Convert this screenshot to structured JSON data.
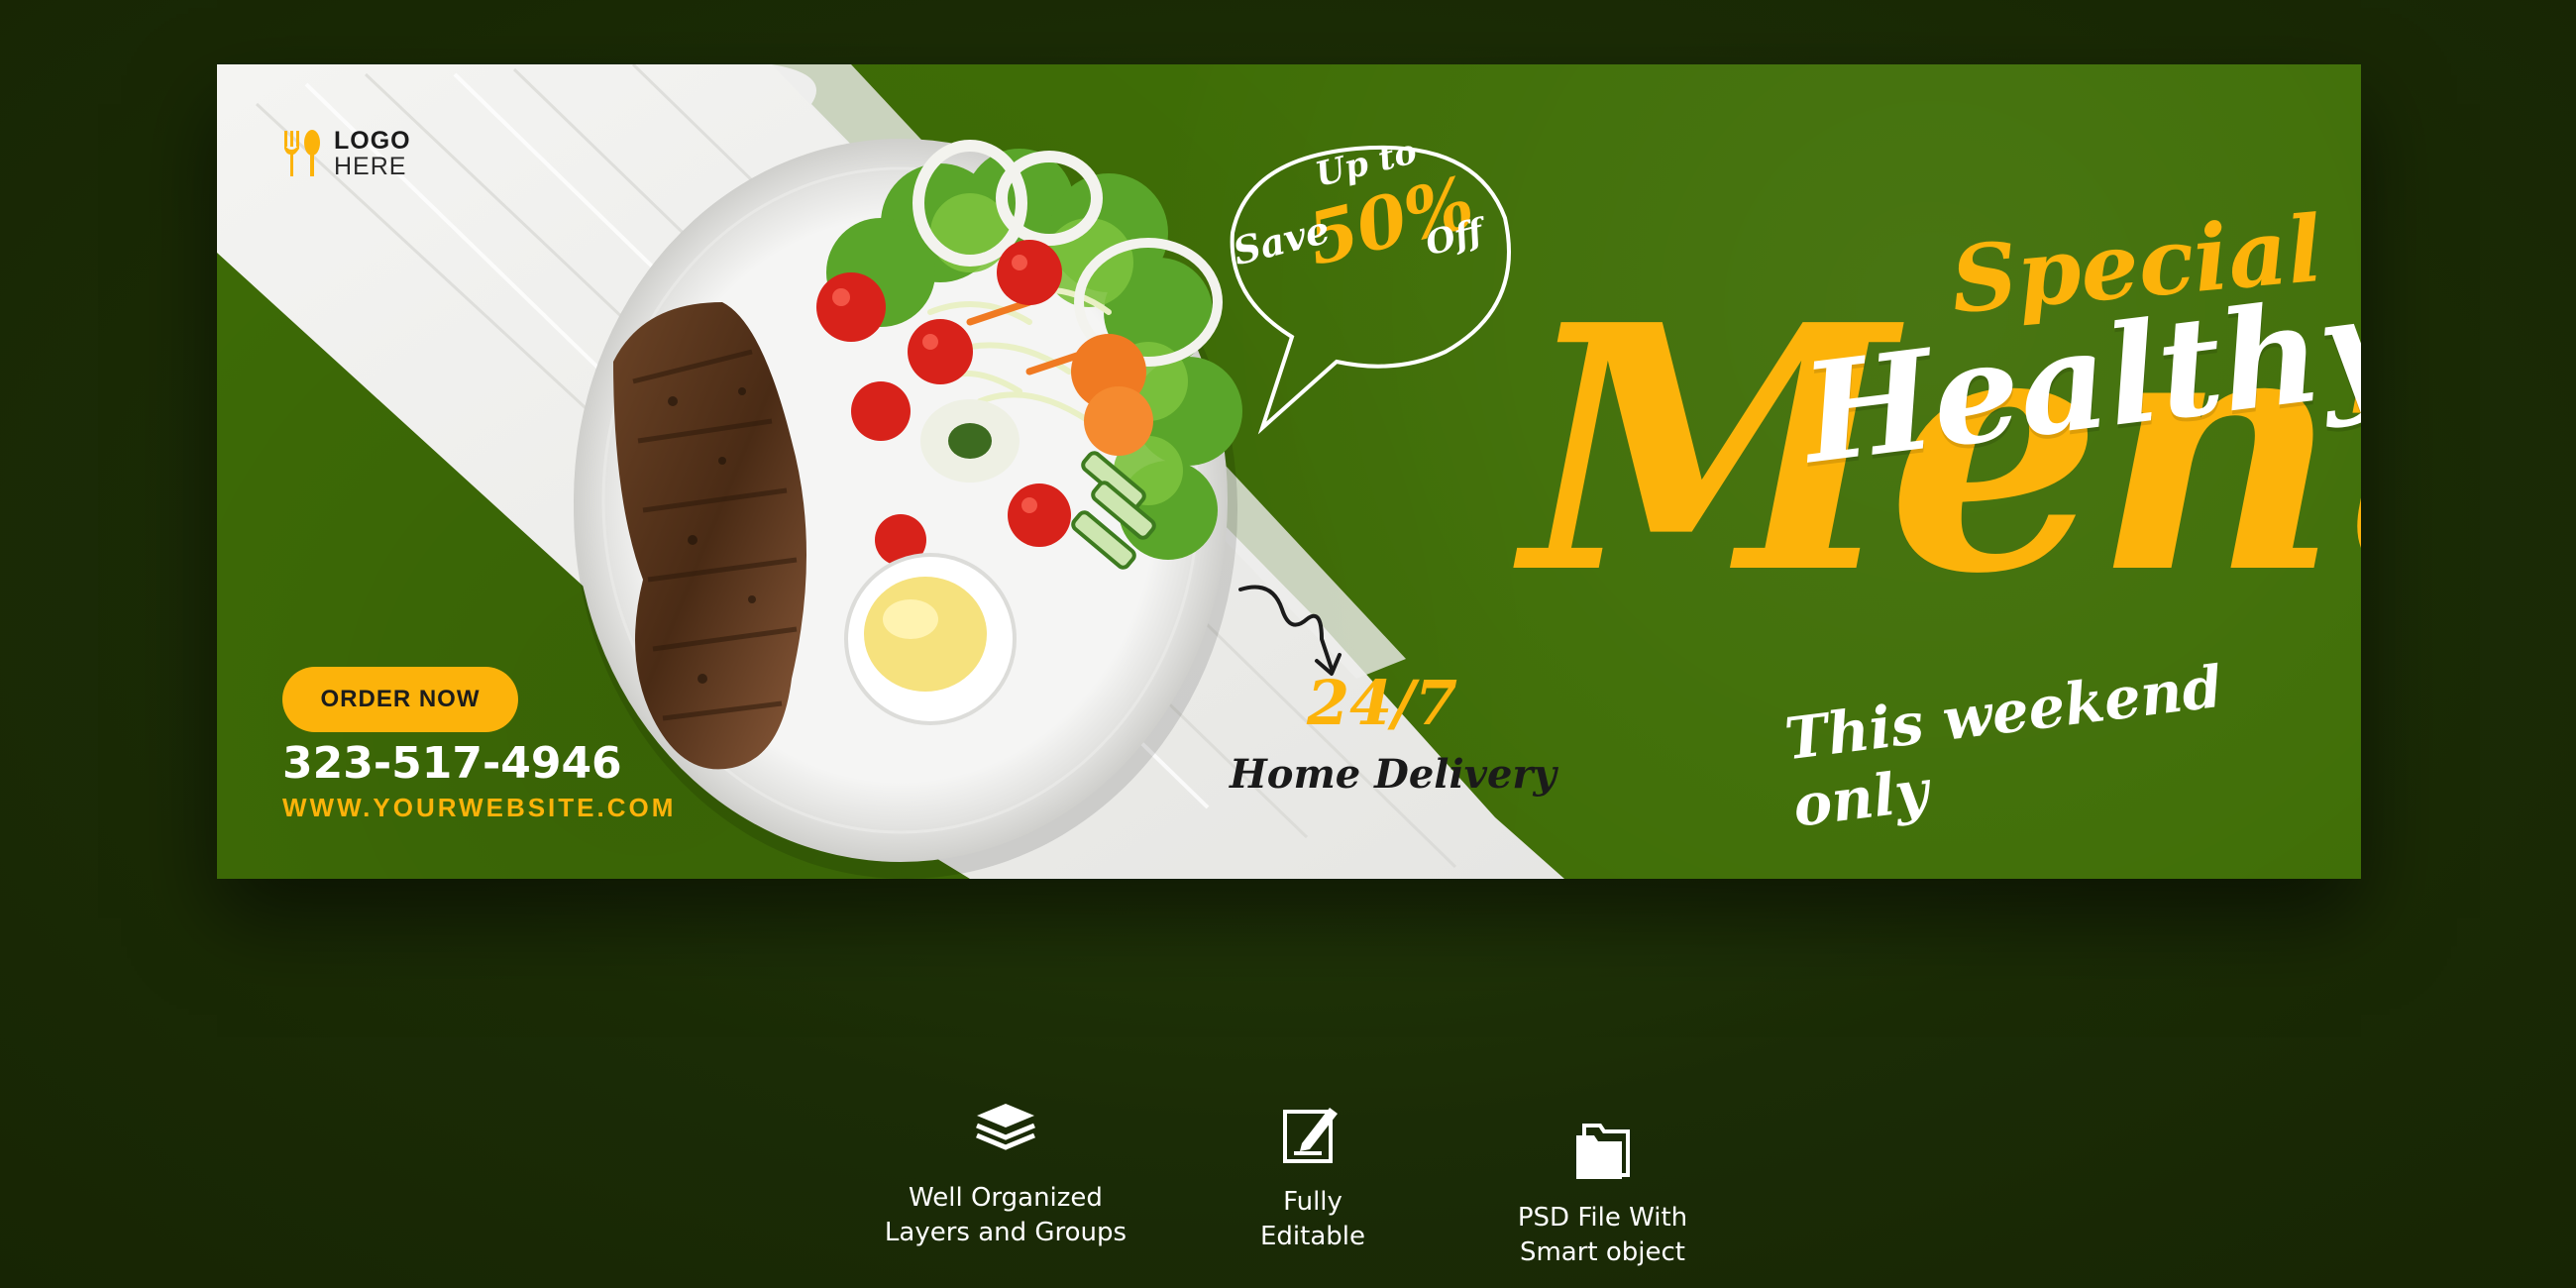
{
  "banner": {
    "logo": {
      "line1": "LOGO",
      "line2": "HERE",
      "icon": "fork-spoon-icon"
    },
    "order_button": "ORDER NOW",
    "phone": "323-517-4946",
    "website": "WWW.YOURWEBSITE.COM",
    "offer": {
      "up_to": "Up to",
      "save": "Save",
      "percent": "50%",
      "off": "Off"
    },
    "delivery": {
      "hours": "24/7",
      "label": "Home Delivery"
    },
    "headline": {
      "special": "Special",
      "healthy": "Healthy",
      "menu": "Menu",
      "tagline": "This weekend only"
    },
    "colors": {
      "green": "#3f6e06",
      "accent": "#fcb30a",
      "white": "#ffffff",
      "dark": "#1e3008"
    }
  },
  "features": [
    {
      "icon": "layers-icon",
      "line1": "Well Organized",
      "line2": "Layers and Groups"
    },
    {
      "icon": "edit-icon",
      "line1": "Fully",
      "line2": "Editable"
    },
    {
      "icon": "folder-icon",
      "line1": "PSD File With",
      "line2": "Smart object"
    }
  ]
}
